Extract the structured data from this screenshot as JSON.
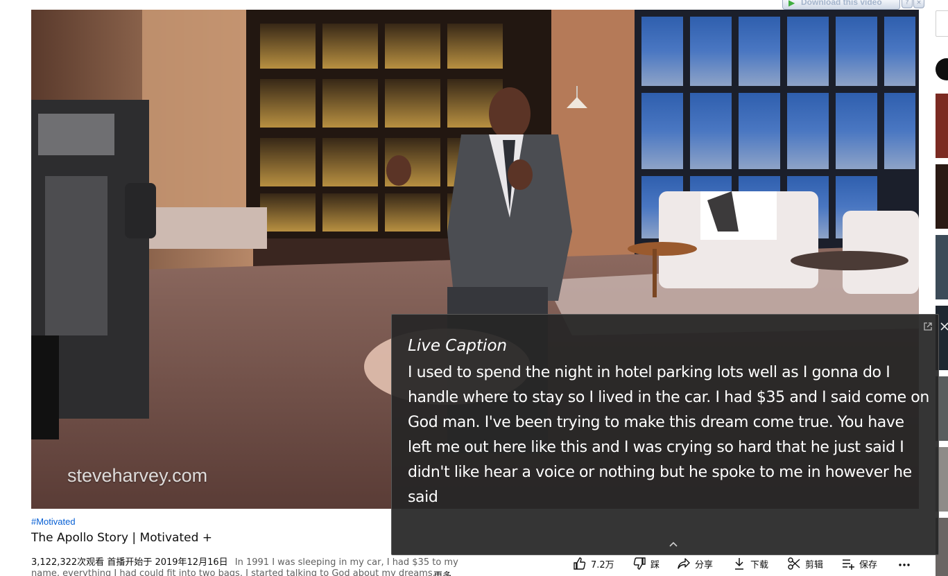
{
  "video": {
    "watermark": "steveharvey.com"
  },
  "download_bar": {
    "label": "Download this video",
    "help_icon": "question-icon",
    "close_icon": "close-icon"
  },
  "caption": {
    "title": "Live Caption",
    "text": "I used to spend the night in hotel parking lots well as I gonna do I handle where to stay so I lived in the car. I had $35 and I said come on God man. I've been trying to make this dream come true. You have left me out here like this and I was crying so hard that he just said I didn't like hear a voice or nothing but he spoke to me in however he said",
    "popout_icon": "popout-icon",
    "close_icon": "close-icon",
    "expand_icon": "chevron-up-icon"
  },
  "details": {
    "hashtag": "#Motivated",
    "title": "The Apollo Story | Motivated +",
    "views": "3,122,322次观看",
    "premiered": "首播开始于 2019年12月16日",
    "description_line1": "In 1991 I was sleeping in my car, I had $35 to my",
    "description_line2": "name, everything I had could fit into two bags. I started talking to God about my dreams.",
    "more": "更多"
  },
  "actions": {
    "like_count": "7.2万",
    "dislike": "踩",
    "share": "分享",
    "download": "下载",
    "clip": "剪辑",
    "save": "保存"
  }
}
